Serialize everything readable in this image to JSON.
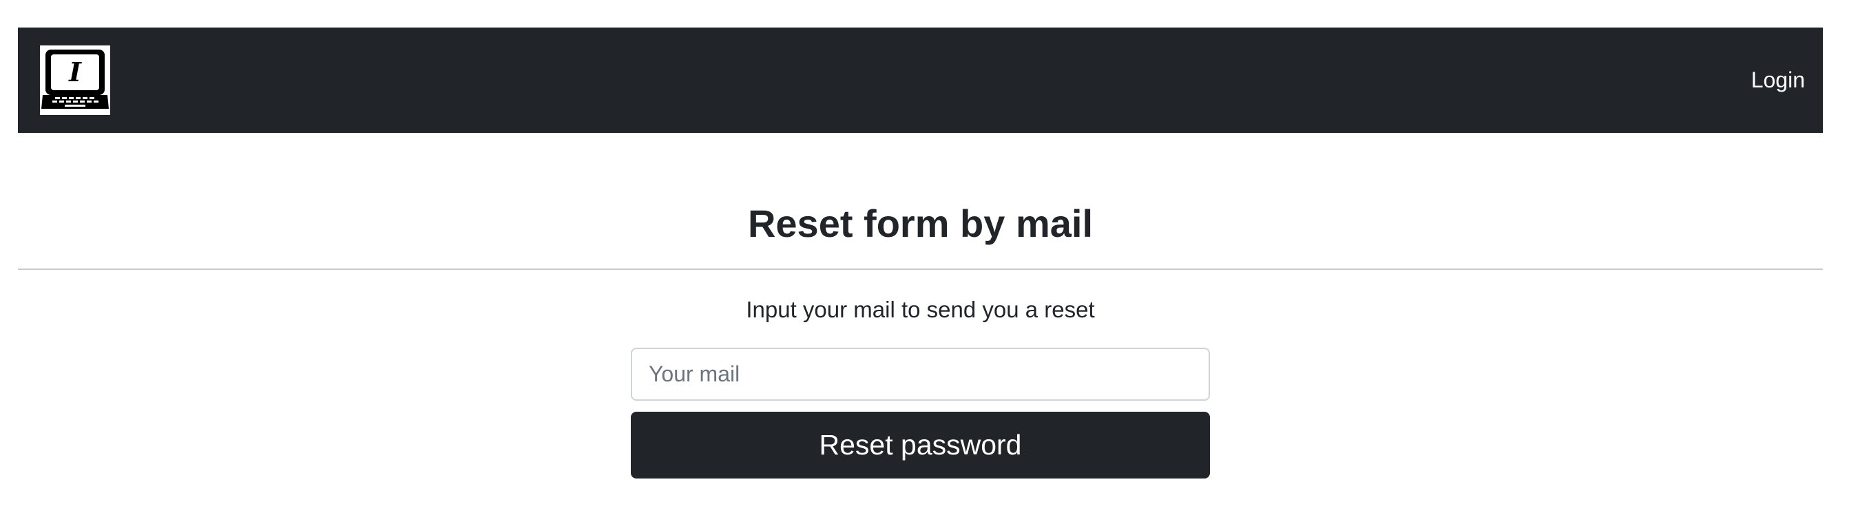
{
  "navbar": {
    "logo_icon": "laptop-icon",
    "logo_letter": "I",
    "login_label": "Login",
    "background_color": "#212529"
  },
  "main": {
    "title": "Reset form by mail",
    "subtitle": "Input your mail to send you a reset",
    "mail_input": {
      "value": "",
      "placeholder": "Your mail"
    },
    "reset_button_label": "Reset password",
    "button_color": "#212529"
  }
}
